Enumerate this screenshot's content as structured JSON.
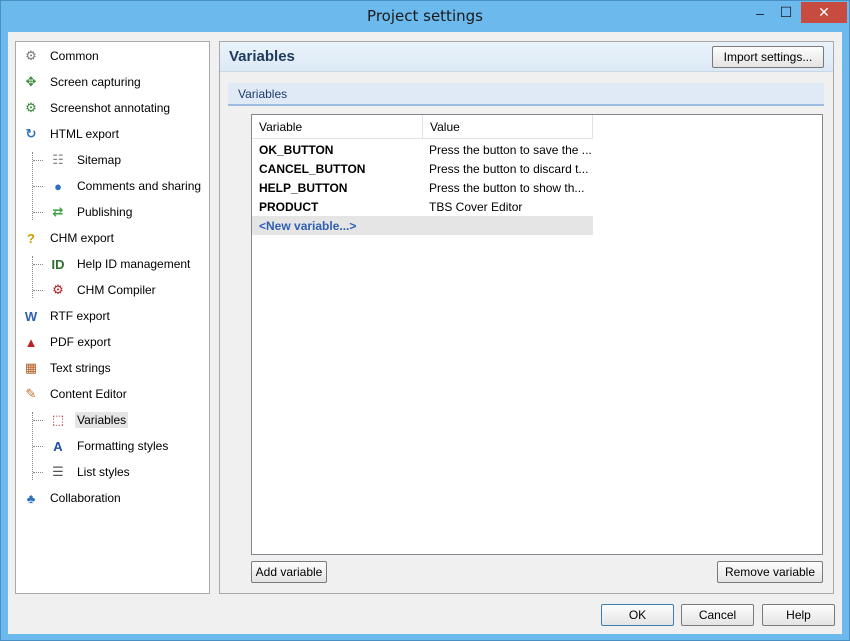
{
  "window": {
    "title": "Project settings"
  },
  "titlebar": {
    "minimize": "–",
    "maximize": "☐",
    "close": "✕"
  },
  "tree": {
    "items": [
      {
        "label": "Common",
        "icon": "gear-icon",
        "glyph": "⚙",
        "color": "#777777"
      },
      {
        "label": "Screen capturing",
        "icon": "screen-capture-icon",
        "glyph": "✥",
        "color": "#3a8a3a"
      },
      {
        "label": "Screenshot annotating",
        "icon": "annotate-icon",
        "glyph": "⚙",
        "color": "#3a8a3a"
      },
      {
        "label": "HTML export",
        "icon": "html-export-icon",
        "glyph": "↻",
        "color": "#2e6fc0"
      },
      {
        "label": "Sitemap",
        "icon": "sitemap-icon",
        "glyph": "☷",
        "color": "#888888"
      },
      {
        "label": "Comments and sharing",
        "icon": "comments-icon",
        "glyph": "●",
        "color": "#2e6fc0"
      },
      {
        "label": "Publishing",
        "icon": "publishing-icon",
        "glyph": "⇄",
        "color": "#3aa040"
      },
      {
        "label": "CHM export",
        "icon": "chm-export-icon",
        "glyph": "?",
        "color": "#c8a000"
      },
      {
        "label": "Help ID management",
        "icon": "help-id-icon",
        "glyph": "ID",
        "color": "#2f6b2f"
      },
      {
        "label": "CHM Compiler",
        "icon": "chm-compiler-icon",
        "glyph": "⚙",
        "color": "#b02020"
      },
      {
        "label": "RTF export",
        "icon": "rtf-export-icon",
        "glyph": "W",
        "color": "#2e5fb0"
      },
      {
        "label": "PDF export",
        "icon": "pdf-export-icon",
        "glyph": "▲",
        "color": "#c02020"
      },
      {
        "label": "Text strings",
        "icon": "text-strings-icon",
        "glyph": "▦",
        "color": "#b05a20"
      },
      {
        "label": "Content Editor",
        "icon": "content-editor-icon",
        "glyph": "✎",
        "color": "#c07020"
      },
      {
        "label": "Variables",
        "icon": "variables-icon",
        "glyph": "⬚",
        "color": "#b02020"
      },
      {
        "label": "Formatting styles",
        "icon": "formatting-styles-icon",
        "glyph": "A",
        "color": "#1f4fa0"
      },
      {
        "label": "List styles",
        "icon": "list-styles-icon",
        "glyph": "☰",
        "color": "#555555"
      },
      {
        "label": "Collaboration",
        "icon": "collaboration-icon",
        "glyph": "♣",
        "color": "#2e6fc0"
      }
    ]
  },
  "panel": {
    "title": "Variables",
    "import_label": "Import settings...",
    "section_label": "Variables"
  },
  "grid": {
    "columns": [
      "Variable",
      "Value"
    ],
    "rows": [
      {
        "name": "OK_BUTTON",
        "value": "Press the button to save the ..."
      },
      {
        "name": "CANCEL_BUTTON",
        "value": "Press the button to discard t..."
      },
      {
        "name": "HELP_BUTTON",
        "value": "Press the button to show th..."
      },
      {
        "name": "PRODUCT",
        "value": "TBS Cover Editor"
      }
    ],
    "new_row": "<New variable...>"
  },
  "actions": {
    "add_label": "Add variable",
    "remove_label": "Remove variable"
  },
  "footer": {
    "ok_label": "OK",
    "cancel_label": "Cancel",
    "help_label": "Help"
  }
}
